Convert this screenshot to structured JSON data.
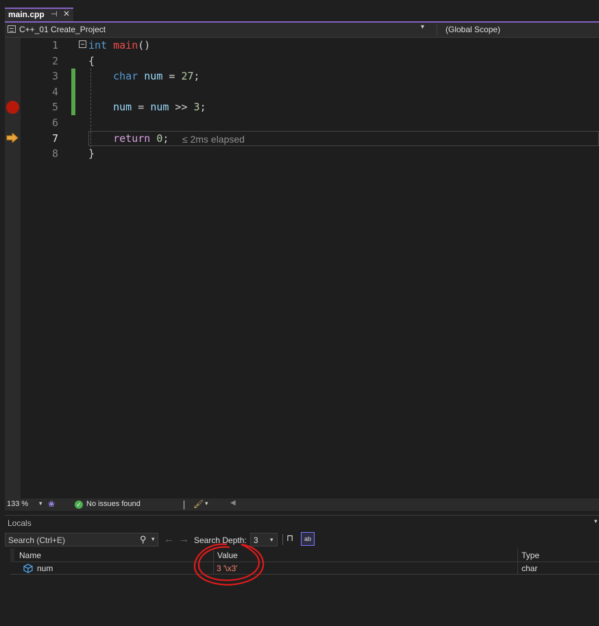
{
  "tab": {
    "title": "main.cpp",
    "pin_icon": "pin-icon",
    "close_icon": "close-icon"
  },
  "navbar": {
    "project": "C++_01 Create_Project",
    "scope": "(Global Scope)"
  },
  "editor": {
    "line_numbers": [
      "1",
      "2",
      "3",
      "4",
      "5",
      "6",
      "7",
      "8"
    ],
    "current_line": "7",
    "breakpoint_line": "5",
    "lines": [
      {
        "parts": [
          [
            "int",
            "kw"
          ],
          [
            " ",
            ""
          ],
          [
            "main",
            "fn"
          ],
          [
            "()",
            ""
          ]
        ]
      },
      {
        "parts": [
          [
            "{",
            ""
          ]
        ]
      },
      {
        "parts": [
          [
            "    ",
            ""
          ],
          [
            "char",
            "kw"
          ],
          [
            " ",
            ""
          ],
          [
            "num",
            "var"
          ],
          [
            " = ",
            ""
          ],
          [
            "27",
            "num"
          ],
          [
            ";",
            ""
          ]
        ]
      },
      {
        "parts": []
      },
      {
        "parts": [
          [
            "    ",
            ""
          ],
          [
            "num",
            "var"
          ],
          [
            " = ",
            ""
          ],
          [
            "num",
            "var"
          ],
          [
            " >> ",
            ""
          ],
          [
            "3",
            "num"
          ],
          [
            ";",
            ""
          ]
        ]
      },
      {
        "parts": []
      },
      {
        "parts": [
          [
            "    ",
            ""
          ],
          [
            "return",
            "rkw"
          ],
          [
            " ",
            ""
          ],
          [
            "0",
            "num"
          ],
          [
            ";",
            ""
          ]
        ]
      },
      {
        "parts": [
          [
            "}",
            ""
          ]
        ]
      }
    ],
    "perf_tip": "≤ 2ms elapsed"
  },
  "status": {
    "zoom": "133 %",
    "issues": "No issues found"
  },
  "locals": {
    "title": "Locals",
    "search_placeholder": "Search (Ctrl+E)",
    "search_depth_label": "Search Depth:",
    "search_depth_value": "3",
    "columns": {
      "name": "Name",
      "value": "Value",
      "type": "Type"
    },
    "rows": [
      {
        "name": "num",
        "value": "3 '\\x3'",
        "type": "char"
      }
    ]
  },
  "colors": {
    "accent": "#8661c5",
    "breakpoint": "#e51400",
    "changed_line": "#57a64a",
    "changed_value": "#f48771",
    "annotation": "#e01b1b"
  }
}
